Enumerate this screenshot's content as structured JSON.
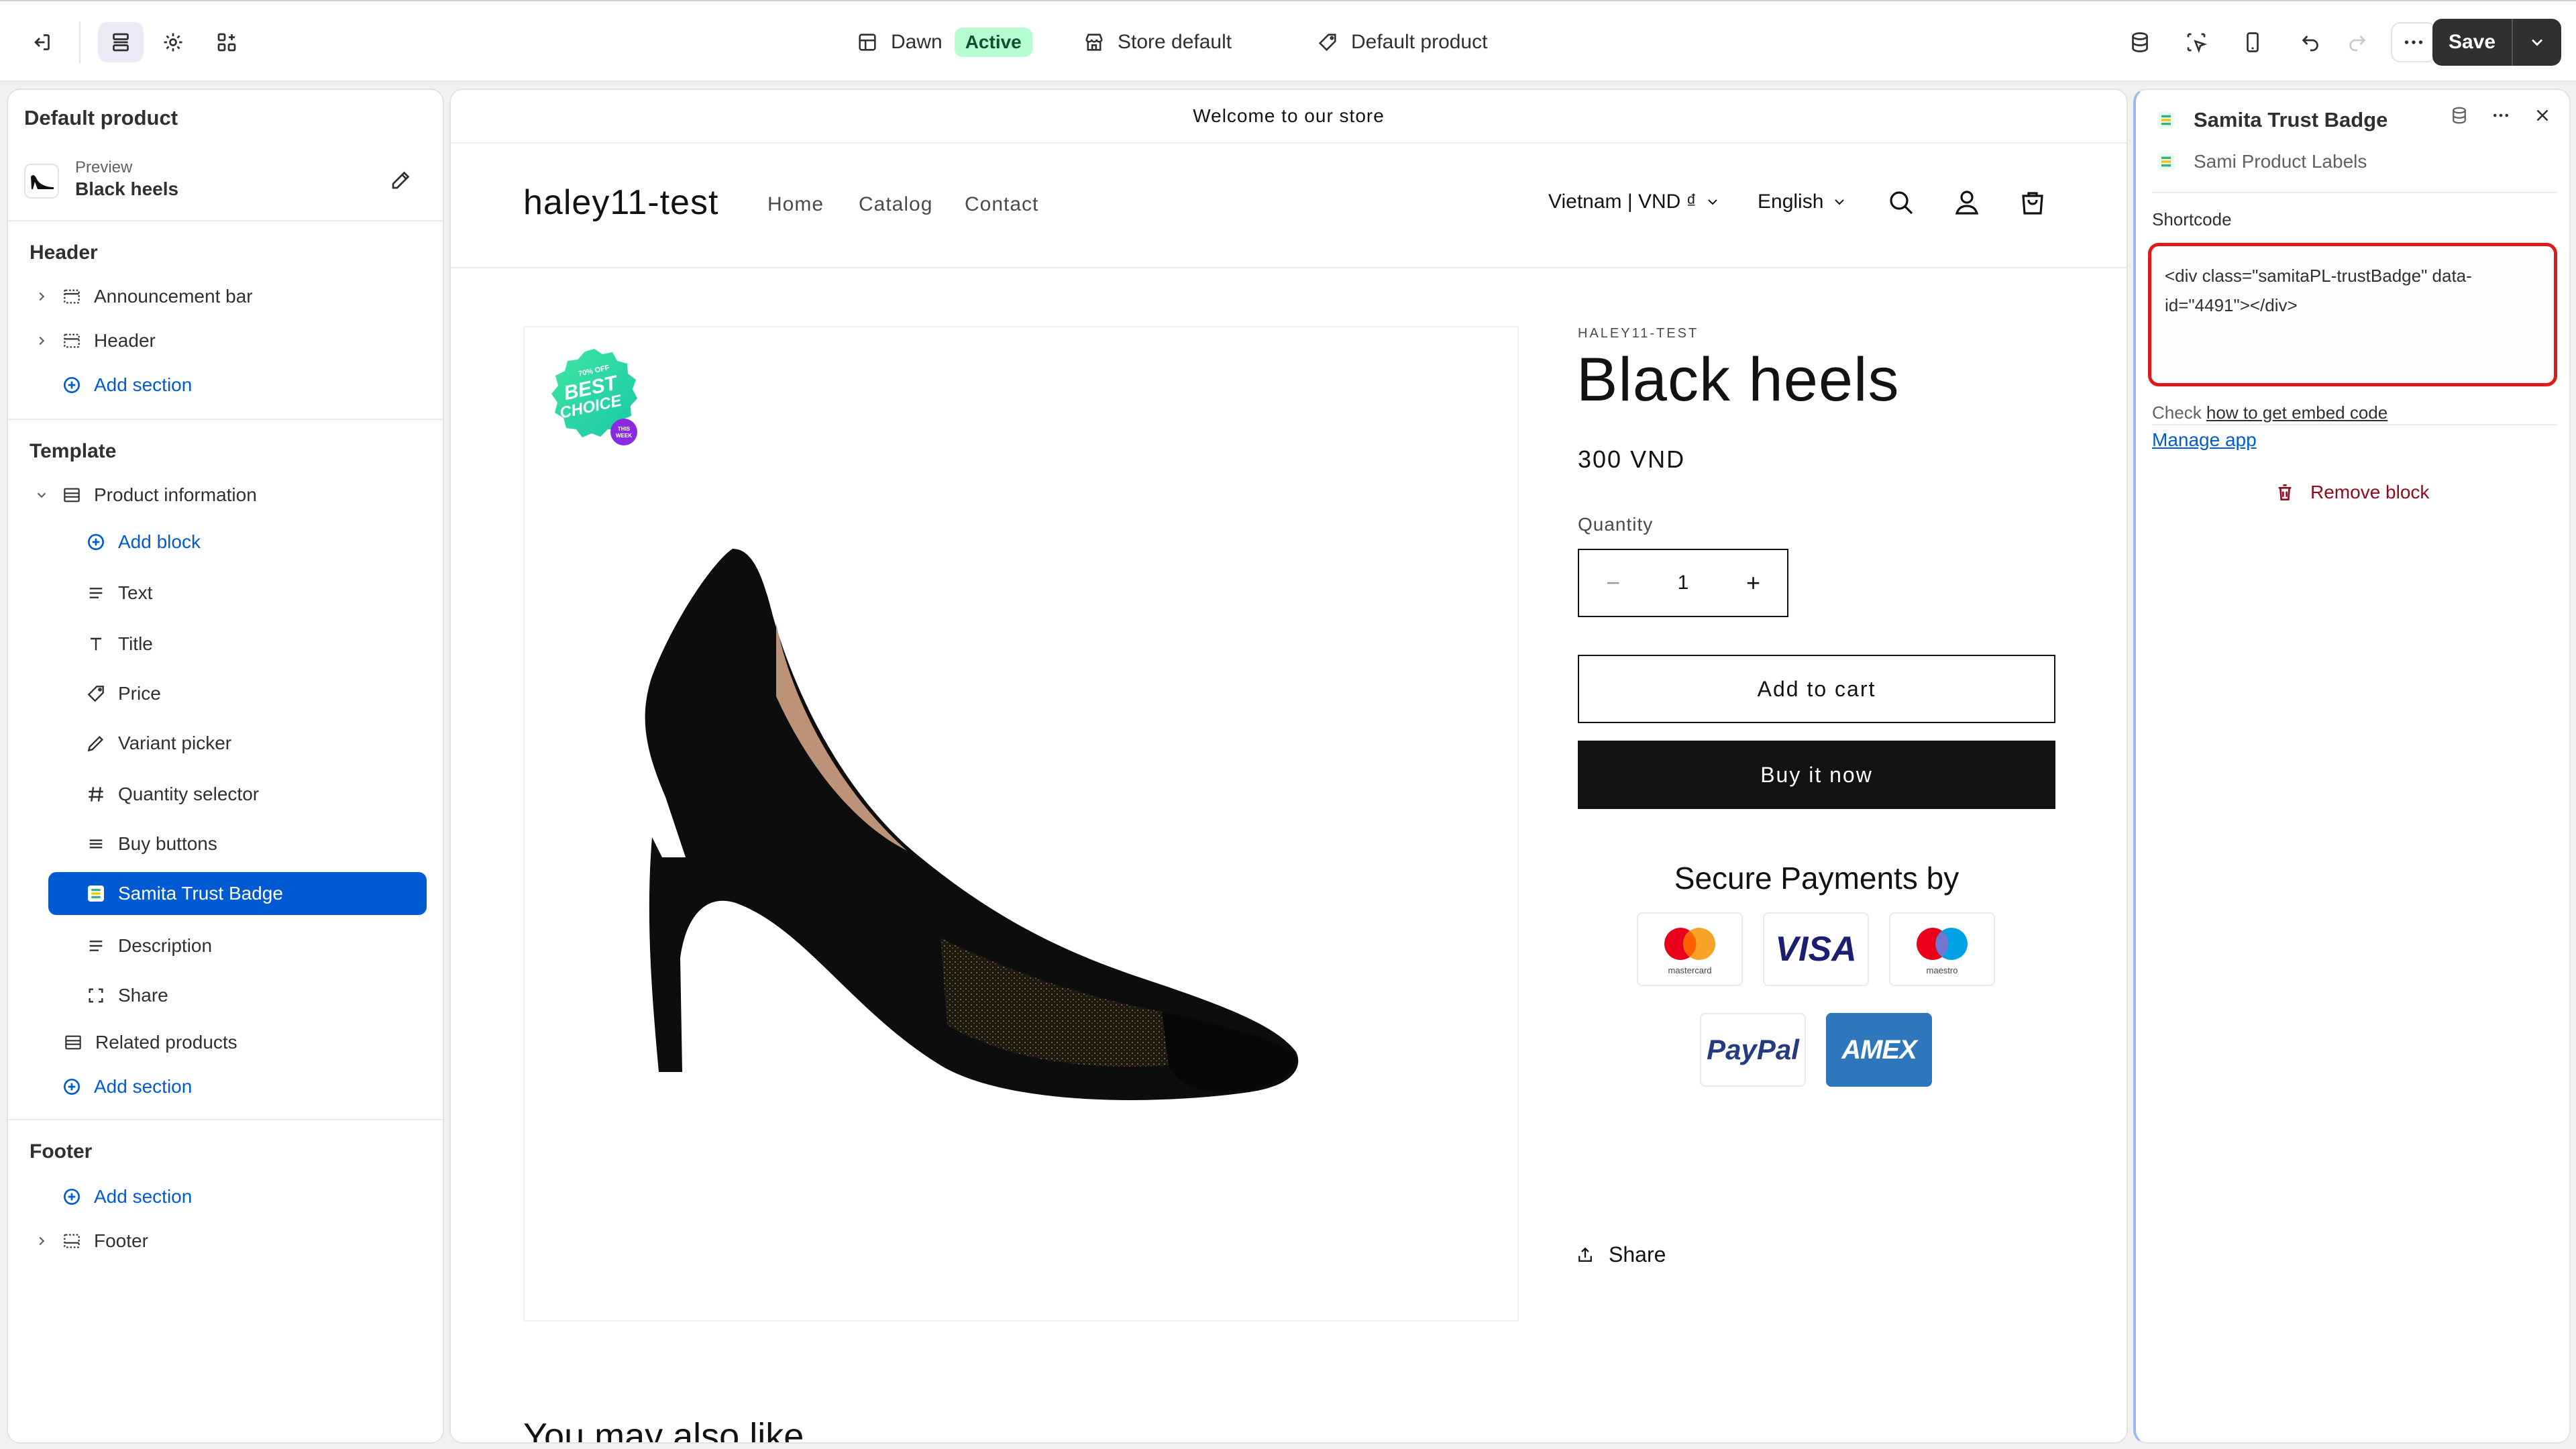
{
  "topbar": {
    "theme_name": "Dawn",
    "theme_status": "Active",
    "store_context": "Store default",
    "template_context": "Default product",
    "save_label": "Save"
  },
  "sidebar": {
    "title": "Default product",
    "preview_label": "Preview",
    "preview_name": "Black heels",
    "header_heading": "Header",
    "header_items": [
      "Announcement bar",
      "Header"
    ],
    "add_section": "Add section",
    "template_heading": "Template",
    "product_information": "Product information",
    "add_block": "Add block",
    "blocks": [
      "Text",
      "Title",
      "Price",
      "Variant picker",
      "Quantity selector",
      "Buy buttons",
      "Samita Trust Badge",
      "Description",
      "Share"
    ],
    "related_products": "Related products",
    "footer_heading": "Footer",
    "footer_item": "Footer"
  },
  "store": {
    "announcement": "Welcome to our store",
    "name": "haley11-test",
    "nav": [
      "Home",
      "Catalog",
      "Contact"
    ],
    "currency": "Vietnam | VND ₫",
    "language": "English",
    "badge_top": "70% OFF",
    "badge_main1": "BEST",
    "badge_main2": "CHOICE",
    "badge_sub1": "THIS",
    "badge_sub2": "WEEK"
  },
  "product": {
    "vendor": "HALEY11-TEST",
    "title": "Black heels",
    "price": "300 VND",
    "quantity_label": "Quantity",
    "quantity": "1",
    "add_to_cart": "Add to cart",
    "buy_now": "Buy it now",
    "secure_title": "Secure Payments by",
    "payments": [
      "mastercard",
      "VISA",
      "maestro",
      "PayPal",
      "AMEX"
    ],
    "share": "Share",
    "also_like": "You may also like"
  },
  "right_panel": {
    "title": "Samita Trust Badge",
    "app_name": "Sami Product Labels",
    "shortcode_label": "Shortcode",
    "shortcode_value": "<div class=\"samitaPL-trustBadge\" data-id=\"4491\"></div>",
    "help_prefix": "Check ",
    "help_link": "how to get embed code",
    "manage_app": "Manage app",
    "remove_block": "Remove block"
  },
  "colors": {
    "accent": "#005bd3",
    "active_badge": "#b4fed2",
    "highlight_border": "#e0191b",
    "remove": "#8e0b21"
  }
}
